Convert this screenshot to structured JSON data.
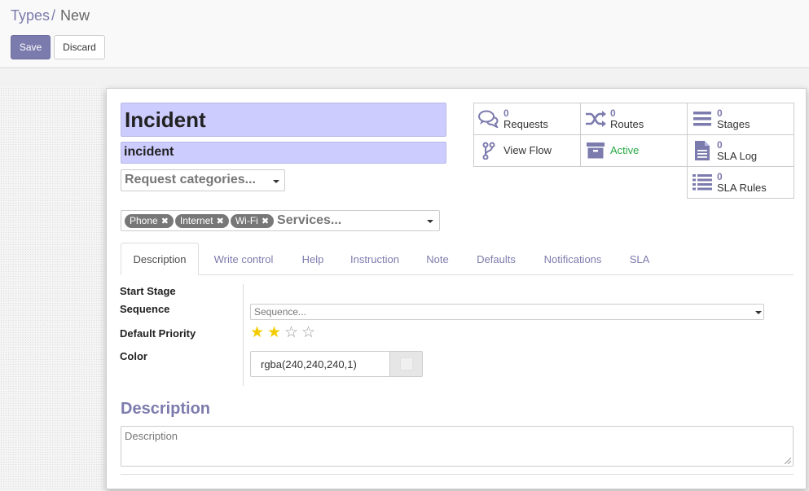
{
  "breadcrumb": {
    "parent": "Types",
    "separator": "/",
    "current": "New"
  },
  "toolbar": {
    "save_label": "Save",
    "discard_label": "Discard"
  },
  "form": {
    "name": "Incident",
    "code": "incident",
    "category_placeholder": "Request categories...",
    "services_placeholder": "Services...",
    "service_tags": [
      "Phone",
      "Internet",
      "Wi-Fi"
    ]
  },
  "smart_buttons": {
    "requests": {
      "count": "0",
      "label": "Requests"
    },
    "routes": {
      "count": "0",
      "label": "Routes"
    },
    "stages": {
      "count": "0",
      "label": "Stages"
    },
    "view_flow": {
      "label": "View Flow"
    },
    "active": {
      "label": "Active"
    },
    "sla_log": {
      "count": "0",
      "label": "SLA Log"
    },
    "sla_rules": {
      "count": "0",
      "label": "SLA Rules"
    }
  },
  "tabs": [
    "Description",
    "Write control",
    "Help",
    "Instruction",
    "Note",
    "Defaults",
    "Notifications",
    "SLA"
  ],
  "fields": {
    "start_stage_label": "Start Stage",
    "sequence_label": "Sequence",
    "sequence_placeholder": "Sequence...",
    "priority_label": "Default Priority",
    "priority_value": 2,
    "priority_max": 4,
    "color_label": "Color",
    "color_value": "rgba(240,240,240,1)"
  },
  "description": {
    "heading": "Description",
    "placeholder": "Description"
  },
  "colors": {
    "accent": "#7c7bad",
    "title_bg": "#ccccff",
    "active": "#28a745",
    "star": "#f3cc00"
  }
}
